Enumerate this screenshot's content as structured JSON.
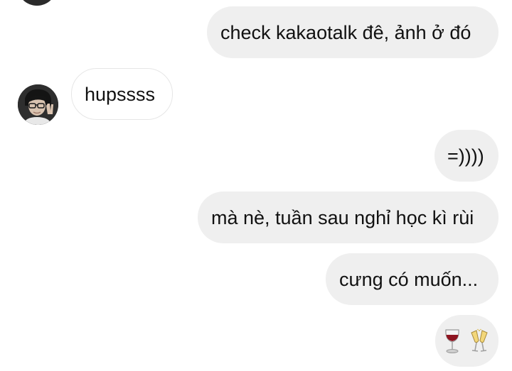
{
  "messages": [
    {
      "side": "outgoing",
      "text": "check kakaotalk đê, ảnh ở đó"
    },
    {
      "side": "incoming",
      "text": "hupssss"
    },
    {
      "side": "outgoing",
      "text": "=))))"
    },
    {
      "side": "outgoing",
      "text": "mà nè, tuần sau nghỉ học kì rùi"
    },
    {
      "side": "outgoing",
      "text": "cưng có muốn..."
    },
    {
      "side": "outgoing",
      "emojis": [
        "wine-glass-emoji",
        "champagne-glasses-emoji"
      ]
    }
  ],
  "colors": {
    "outgoing_bubble": "#efefef",
    "incoming_bubble_border": "#e6e6e6",
    "text": "#111111"
  }
}
